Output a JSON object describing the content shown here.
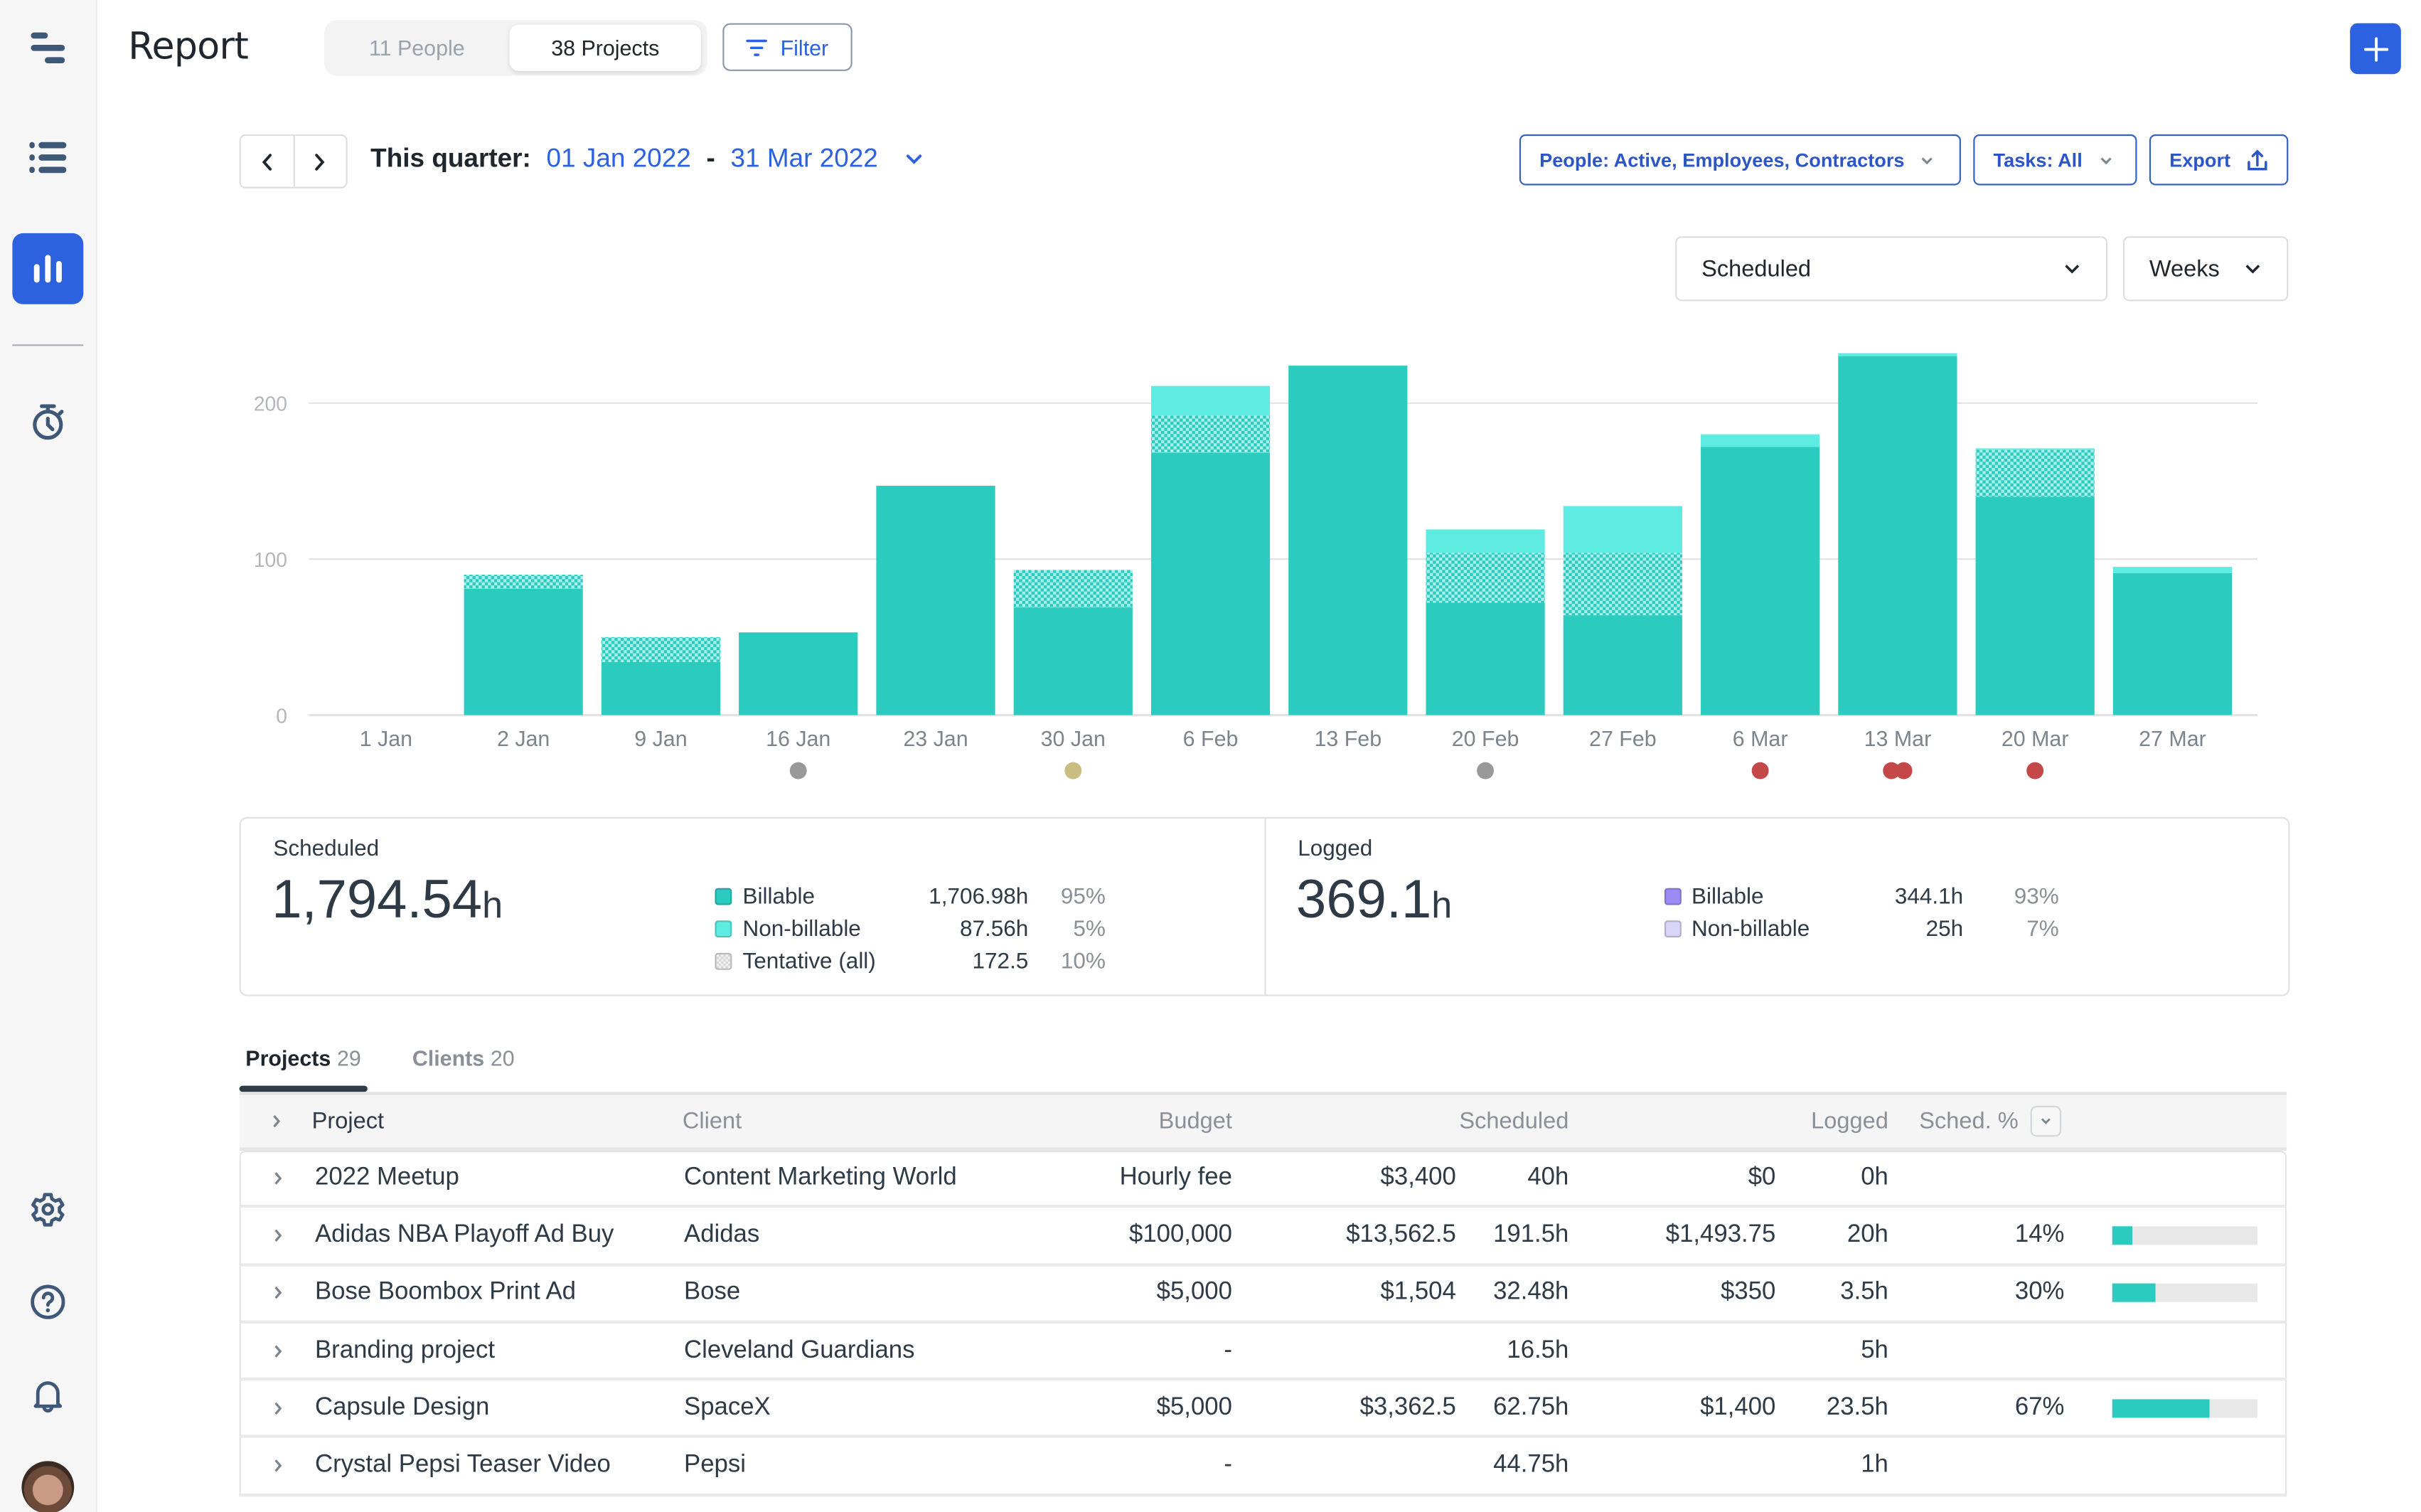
{
  "header": {
    "title": "Report",
    "segments": [
      {
        "label": "11 People",
        "active": false
      },
      {
        "label": "38 Projects",
        "active": true
      }
    ],
    "filter_label": "Filter",
    "add_icon": "plus-icon"
  },
  "sidebar": {
    "items": [
      {
        "name": "schedule",
        "icon": "schedule-icon"
      },
      {
        "name": "projects-list",
        "icon": "list-icon"
      },
      {
        "name": "reports",
        "icon": "bar-chart-icon",
        "active": true
      },
      {
        "name": "time-tracking",
        "icon": "stopwatch-icon"
      },
      {
        "name": "settings",
        "icon": "gear-icon"
      },
      {
        "name": "help",
        "icon": "question-icon"
      },
      {
        "name": "notifications",
        "icon": "bell-icon"
      }
    ]
  },
  "date_range": {
    "label": "This quarter:",
    "start": "01 Jan 2022",
    "separator": "-",
    "end": "31 Mar 2022"
  },
  "filters": {
    "people": "People: Active, Employees, Contractors",
    "tasks": "Tasks: All",
    "export": "Export"
  },
  "chart_controls": {
    "metric": "Scheduled",
    "interval": "Weeks"
  },
  "colors": {
    "accent": "#2c62e0",
    "billable": "#2ccbc0",
    "non_billable": "#5eebe1",
    "tentative_light": "#a8efe9",
    "logged_billable": "#9b8cf5",
    "logged_non_billable": "#d9d5f7",
    "marker_gray": "#999999",
    "marker_gold": "#c9bd82",
    "marker_red": "#c44848"
  },
  "chart_data": {
    "type": "bar",
    "stacked": true,
    "title": "",
    "xlabel": "",
    "ylabel": "",
    "ylim": [
      0,
      240
    ],
    "yticks": [
      0,
      100,
      200
    ],
    "grid": true,
    "categories": [
      "1 Jan",
      "2 Jan",
      "9 Jan",
      "16 Jan",
      "23 Jan",
      "30 Jan",
      "6 Feb",
      "13 Feb",
      "20 Feb",
      "27 Feb",
      "6 Mar",
      "13 Mar",
      "20 Mar",
      "27 Mar"
    ],
    "series": [
      {
        "name": "Billable",
        "values": [
          0,
          81,
          34,
          53,
          147,
          69,
          168,
          224,
          72,
          64,
          172,
          230,
          140,
          91
        ]
      },
      {
        "name": "Tentative",
        "values": [
          0,
          9,
          16,
          0,
          0,
          24,
          24,
          0,
          32,
          40,
          0,
          0,
          30,
          0
        ]
      },
      {
        "name": "Non-billable",
        "values": [
          0,
          0,
          0,
          0,
          0,
          0,
          19,
          0,
          15,
          30,
          8,
          2,
          1,
          4
        ]
      }
    ],
    "markers": [
      {
        "category": "16 Jan",
        "colors": [
          "gray"
        ]
      },
      {
        "category": "30 Jan",
        "colors": [
          "gold"
        ]
      },
      {
        "category": "20 Feb",
        "colors": [
          "gray"
        ]
      },
      {
        "category": "6 Mar",
        "colors": [
          "red"
        ]
      },
      {
        "category": "13 Mar",
        "colors": [
          "red",
          "red"
        ]
      },
      {
        "category": "20 Mar",
        "colors": [
          "red"
        ]
      }
    ]
  },
  "summary": {
    "scheduled": {
      "label": "Scheduled",
      "total": "1,794.54",
      "unit": "h",
      "rows": [
        {
          "name": "Billable",
          "value": "1,706.98h",
          "pct": "95%",
          "swatch": "billable"
        },
        {
          "name": "Non-billable",
          "value": "87.56h",
          "pct": "5%",
          "swatch": "non_billable"
        },
        {
          "name": "Tentative (all)",
          "value": "172.5",
          "pct": "10%",
          "swatch": "tentative"
        }
      ]
    },
    "logged": {
      "label": "Logged",
      "total": "369.1",
      "unit": "h",
      "rows": [
        {
          "name": "Billable",
          "value": "344.1h",
          "pct": "93%",
          "swatch": "logged_billable"
        },
        {
          "name": "Non-billable",
          "value": "25h",
          "pct": "7%",
          "swatch": "logged_non_billable"
        }
      ]
    }
  },
  "tabs": [
    {
      "label": "Projects",
      "count": "29",
      "active": true
    },
    {
      "label": "Clients",
      "count": "20",
      "active": false
    }
  ],
  "table": {
    "columns": {
      "project": "Project",
      "client": "Client",
      "budget": "Budget",
      "scheduled": "Scheduled",
      "logged": "Logged",
      "sched_pct": "Sched. %"
    },
    "rows": [
      {
        "project": "2022 Meetup",
        "client": "Content Marketing World",
        "budget": "Hourly fee",
        "sched_amount": "$3,400",
        "sched_hours": "40h",
        "logged_amount": "$0",
        "logged_hours": "0h",
        "pct": "",
        "pct_value": null
      },
      {
        "project": "Adidas NBA Playoff Ad Buy",
        "client": "Adidas",
        "budget": "$100,000",
        "sched_amount": "$13,562.5",
        "sched_hours": "191.5h",
        "logged_amount": "$1,493.75",
        "logged_hours": "20h",
        "pct": "14%",
        "pct_value": 14
      },
      {
        "project": "Bose Boombox Print Ad",
        "client": "Bose",
        "budget": "$5,000",
        "sched_amount": "$1,504",
        "sched_hours": "32.48h",
        "logged_amount": "$350",
        "logged_hours": "3.5h",
        "pct": "30%",
        "pct_value": 30
      },
      {
        "project": "Branding project",
        "client": "Cleveland Guardians",
        "budget": "-",
        "sched_amount": "",
        "sched_hours": "16.5h",
        "logged_amount": "",
        "logged_hours": "5h",
        "pct": "",
        "pct_value": null
      },
      {
        "project": "Capsule Design",
        "client": "SpaceX",
        "budget": "$5,000",
        "sched_amount": "$3,362.5",
        "sched_hours": "62.75h",
        "logged_amount": "$1,400",
        "logged_hours": "23.5h",
        "pct": "67%",
        "pct_value": 67
      },
      {
        "project": "Crystal Pepsi Teaser Video",
        "client": "Pepsi",
        "budget": "-",
        "sched_amount": "",
        "sched_hours": "44.75h",
        "logged_amount": "",
        "logged_hours": "1h",
        "pct": "",
        "pct_value": null
      }
    ]
  }
}
